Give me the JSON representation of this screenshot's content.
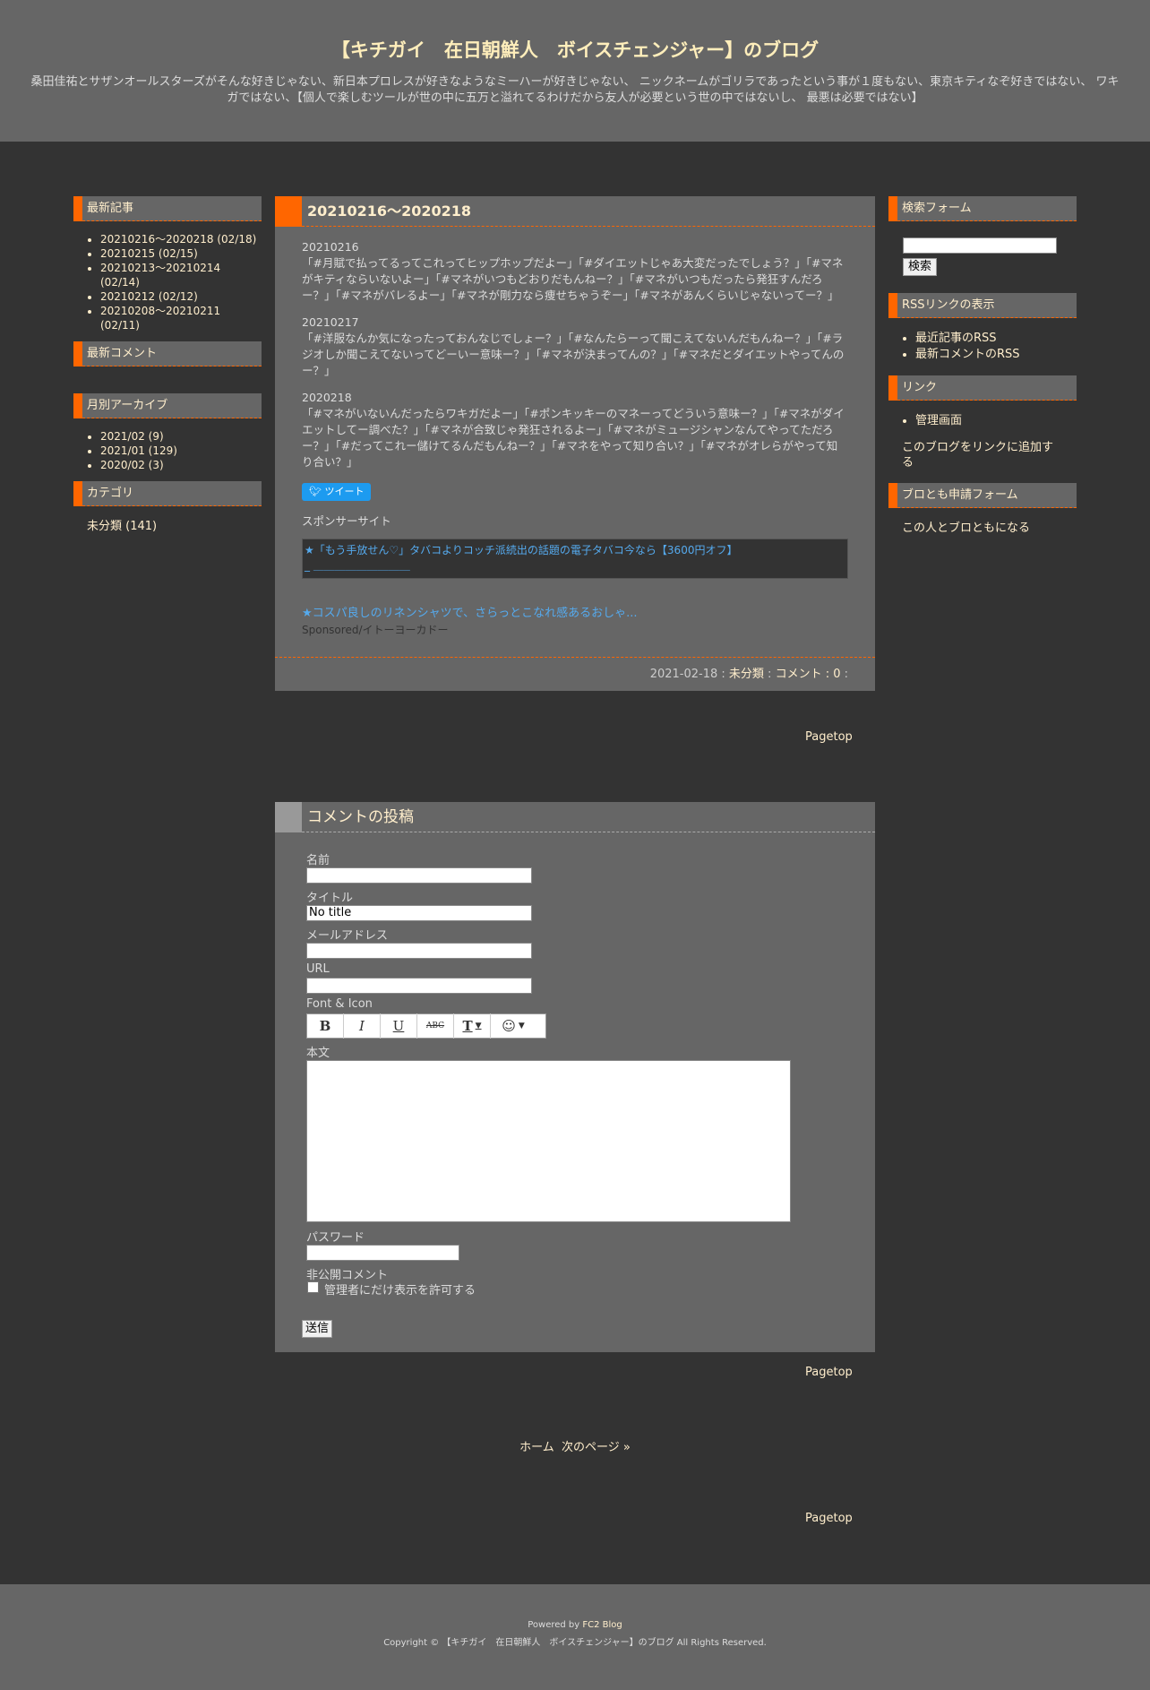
{
  "header": {
    "title": "【キチガイ　在日朝鮮人　ボイスチェンジャー】のブログ",
    "description": "桑田佳祐とサザンオールスターズがそんな好きじゃない、新日本プロレスが好きなようなミーハーが好きじゃない、 ニックネームがゴリラであったという事が１度もない、東京キティなぞ好きではない、 ワキガではない、【個人で楽しむツールが世の中に五万と溢れてるわけだから友人が必要という世の中ではないし、 最悪は必要ではない】"
  },
  "left": {
    "recent_title": "最新記事",
    "recent": [
      {
        "label": "20210216～2020218 (02/18)"
      },
      {
        "label": "20210215 (02/15)"
      },
      {
        "label": "20210213～20210214 (02/14)"
      },
      {
        "label": "20210212 (02/12)"
      },
      {
        "label": "20210208～20210211 (02/11)"
      }
    ],
    "comments_title": "最新コメント",
    "archive_title": "月別アーカイブ",
    "archive": [
      {
        "label": "2021/02 (9)"
      },
      {
        "label": "2021/01 (129)"
      },
      {
        "label": "2020/02 (3)"
      }
    ],
    "category_title": "カテゴリ",
    "category": "未分類 (141)"
  },
  "right": {
    "search_title": "検索フォーム",
    "search_button": "検索",
    "rss_title": "RSSリンクの表示",
    "rss": [
      {
        "label": "最近記事のRSS"
      },
      {
        "label": "最新コメントのRSS"
      }
    ],
    "link_title": "リンク",
    "links": [
      {
        "label": "管理画面"
      }
    ],
    "add_link": "このブログをリンクに追加する",
    "friend_title": "ブロとも申請フォーム",
    "friend_link": "この人とブロともになる"
  },
  "entry": {
    "title": "20210216～2020218",
    "paragraphs": [
      {
        "date": "20210216",
        "text": "「#月賦で払ってるってこれってヒップホップだよー」「#ダイエットじゃあ大変だったでしょう？」「#マネがキティならいないよー」「#マネがいつもどおりだもんねー？」「#マネがいつもだったら発狂すんだろー？」「#マネがバレるよー」「#マネが剛力なら痩せちゃうぞー」「#マネがあんくらいじゃないってー？」"
      },
      {
        "date": "20210217",
        "text": "「#洋服なんか気になったっておんなじでしょー？」「#なんたらーって聞こえてないんだもんねー？」「#ラジオしか聞こえてないってどーいー意味ー？」「#マネが決まってんの？」「#マネだとダイエットやってんのー？」"
      },
      {
        "date": "2020218",
        "text": "「#マネがいないんだったらワキガだよー」「#ポンキッキーのマネーってどういう意味ー？」「#マネがダイエットしてー調べた？」「#マネが合致じゃ発狂されるよー」「#マネがミュージシャンなんてやってただろー？」「#だってこれー儲けてるんだもんねー？」「#マネをやって知り合い？」「#マネがオレらがやって知り合い？」"
      }
    ],
    "tweet": "ツイート",
    "sponsor_label": "スポンサーサイト",
    "sponsor_ad": "★「もう手放せん♡」タバコよりコッチ派続出の話題の電子タバコ今なら【3600円オフ】",
    "sponsor_ad_line2": "_ ＿＿＿＿＿＿＿＿＿",
    "sponsor_ad2": "★コスパ良しのリネンシャツで、さらっとこなれ感あるおしゃ...",
    "sponsor_ad2_sub": "Sponsored/イトーヨーカドー",
    "foot_date": "2021-02-18 : ",
    "foot_category": "未分類",
    "foot_sep": " : ",
    "foot_comment": "コメント : 0",
    "foot_end": " :"
  },
  "pagetop": "Pagetop",
  "comment_form": {
    "title": "コメントの投稿",
    "name_label": "名前",
    "title_label": "タイトル",
    "title_value": "No title",
    "email_label": "メールアドレス",
    "url_label": "URL",
    "font_label": "Font & Icon",
    "body_label": "本文",
    "password_label": "パスワード",
    "private_label": "非公開コメント",
    "private_checkbox": "管理者にだけ表示を許可する",
    "submit": "送信"
  },
  "pager": {
    "home": "ホーム",
    "next": "次のページ »"
  },
  "footer": {
    "powered_prefix": "Powered by ",
    "powered_link": "FC2 Blog",
    "copyright": "Copyright © 【キチガイ　在日朝鮮人　ボイスチェンジャー】のブログ All Rights Reserved."
  }
}
